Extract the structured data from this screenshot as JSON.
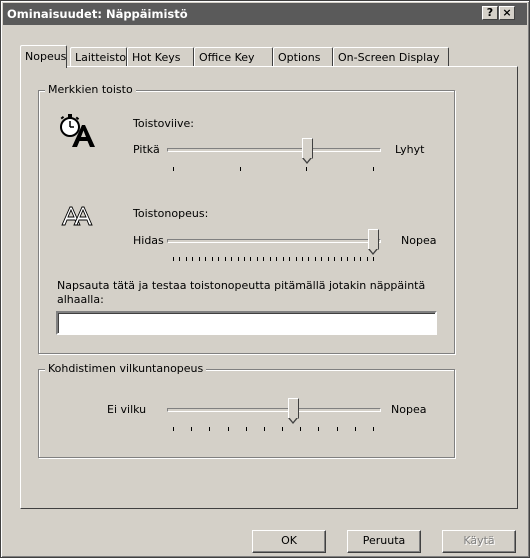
{
  "window": {
    "title": "Ominaisuudet: Näppäimistö",
    "help_button": "?",
    "close_button": "×"
  },
  "tabs": [
    {
      "label": "Nopeus",
      "active": true
    },
    {
      "label": "Laitteisto",
      "active": false
    },
    {
      "label": "Hot Keys",
      "active": false
    },
    {
      "label": "Office Key",
      "active": false
    },
    {
      "label": "Options",
      "active": false
    },
    {
      "label": "On-Screen Display",
      "active": false
    }
  ],
  "repeat_group": {
    "title": "Merkkien toisto",
    "delay": {
      "label": "Toistoviive:",
      "min_label": "Pitkä",
      "max_label": "Lyhyt",
      "ticks": 4,
      "level": 0.67,
      "icon": "stopwatch-a-icon"
    },
    "rate": {
      "label": "Toistonopeus:",
      "min_label": "Hidas",
      "max_label": "Nopea",
      "ticks": 32,
      "level": 1.0,
      "icon": "repeat-aa-icon"
    },
    "test_label": "Napsauta tätä ja testaa toistonopeutta pitämällä jotakin näppäintä alhaalla:",
    "test_value": ""
  },
  "cursor_group": {
    "title": "Kohdistimen vilkuntanopeus",
    "blink": {
      "min_label": "Ei vilku",
      "max_label": "Nopea",
      "ticks": 12,
      "level": 0.6
    }
  },
  "buttons": {
    "ok": "OK",
    "cancel": "Peruuta",
    "apply": "Käytä"
  }
}
